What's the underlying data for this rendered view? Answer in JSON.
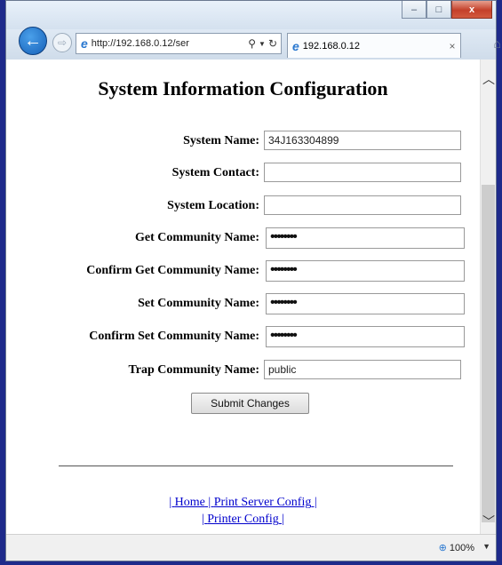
{
  "window": {
    "minimize_label": "–",
    "maximize_label": "□",
    "close_label": "x"
  },
  "nav": {
    "address": "http://192.168.0.12/ser",
    "tab_title": "192.168.0.12",
    "tab_close": "×"
  },
  "page": {
    "title": "System Information Configuration",
    "fields": [
      {
        "label": "System Name:",
        "value": "34J163304899",
        "type": "text"
      },
      {
        "label": "System Contact:",
        "value": "",
        "type": "text"
      },
      {
        "label": "System Location:",
        "value": "",
        "type": "text"
      },
      {
        "label": "Get Community Name:",
        "value": "••••••••",
        "type": "password"
      },
      {
        "label": "Confirm Get Community Name:",
        "value": "••••••••",
        "type": "password"
      },
      {
        "label": "Set Community Name:",
        "value": "••••••••",
        "type": "password"
      },
      {
        "label": "Confirm Set Community Name:",
        "value": "••••••••",
        "type": "password"
      },
      {
        "label": "Trap Community Name:",
        "value": "public",
        "type": "text"
      }
    ],
    "submit_label": "Submit Changes",
    "links": {
      "sep1": "| ",
      "home": "Home",
      "sep2": " | ",
      "print_server": "Print Server Config",
      "sep3": " |",
      "sep4": "| ",
      "printer": "Printer Config",
      "sep5": " |"
    }
  },
  "status": {
    "zoom": "100%"
  }
}
